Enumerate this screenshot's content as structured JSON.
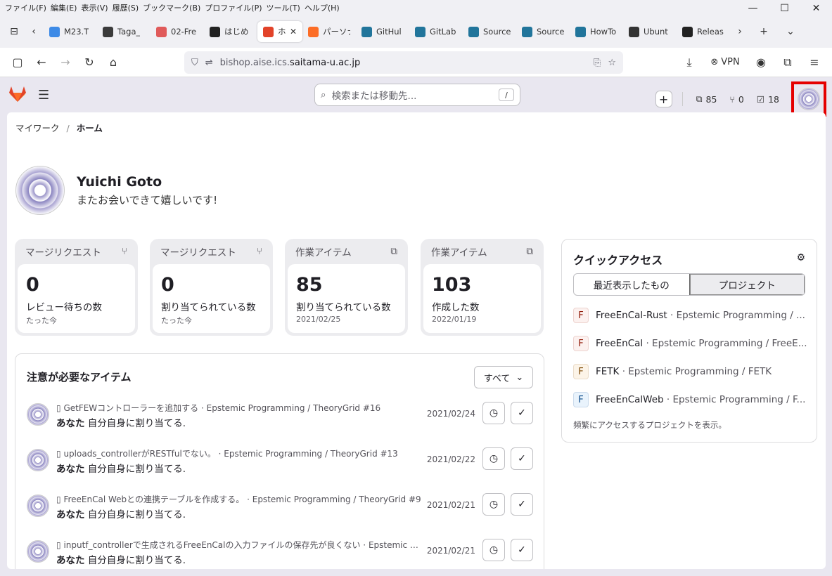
{
  "menu": [
    "ファイル(F)",
    "編集(E)",
    "表示(V)",
    "履歴(S)",
    "ブックマーク(B)",
    "プロファイル(P)",
    "ツール(T)",
    "ヘルプ(H)"
  ],
  "tabs": [
    {
      "label": "M23.T",
      "color": "#3d8ae6"
    },
    {
      "label": "Taga_",
      "color": "#3b3b3b"
    },
    {
      "label": "02-Fre",
      "color": "#e05a5a"
    },
    {
      "label": "はじめ",
      "color": "#222"
    },
    {
      "label": "ホー",
      "color": "#e24329",
      "active": true
    },
    {
      "label": "パーソナ",
      "color": "#fc6d26"
    },
    {
      "label": "GitHul",
      "color": "#21759b"
    },
    {
      "label": "GitLab",
      "color": "#21759b"
    },
    {
      "label": "Source",
      "color": "#21759b"
    },
    {
      "label": "Source",
      "color": "#21759b"
    },
    {
      "label": "HowTo",
      "color": "#21759b"
    },
    {
      "label": "Ubunt",
      "color": "#333"
    },
    {
      "label": "Releas",
      "color": "#222"
    }
  ],
  "url": {
    "prefix": "bishop.aise.ics.",
    "domain": "saitama-u.ac.jp"
  },
  "vpn": "VPN",
  "gl": {
    "search_placeholder": "検索または移動先...",
    "kbd": "/",
    "counts": {
      "issues": "85",
      "mrs": "0",
      "todos": "18"
    }
  },
  "breadcrumb": {
    "parent": "マイワーク",
    "sep": "/",
    "current": "ホーム"
  },
  "user": {
    "name": "Yuichi Goto",
    "greeting": "またお会いできて嬉しいです!"
  },
  "cards": [
    {
      "title": "マージリクエスト",
      "num": "0",
      "label": "レビュー待ちの数",
      "sub": "たった今"
    },
    {
      "title": "マージリクエスト",
      "num": "0",
      "label": "割り当てられている数",
      "sub": "たった今"
    },
    {
      "title": "作業アイテム",
      "num": "85",
      "label": "割り当てられている数",
      "sub": "2021/02/25"
    },
    {
      "title": "作業アイテム",
      "num": "103",
      "label": "作成した数",
      "sub": "2022/01/19"
    }
  ],
  "attention": {
    "title": "注意が必要なアイテム",
    "filter": "すべて",
    "rows": [
      {
        "text": "GetFEWコントローラーを追加する · Epstemic Programming / TheoryGrid #16",
        "who": "あなた",
        "action": "自分自身に割り当てる.",
        "date": "2021/02/24"
      },
      {
        "text": "uploads_controllerがRESTfulでない。 · Epstemic Programming / TheoryGrid #13",
        "who": "あなた",
        "action": "自分自身に割り当てる.",
        "date": "2021/02/22"
      },
      {
        "text": "FreeEnCal Webとの連携テーブルを作成する。 · Epstemic Programming / TheoryGrid #9",
        "who": "あなた",
        "action": "自分自身に割り当てる.",
        "date": "2021/02/21"
      },
      {
        "text": "inputf_controllerで生成されるFreeEnCalの入力ファイルの保存先が良くない · Epstemic Pr...",
        "who": "あなた",
        "action": "自分自身に割り当てる.",
        "date": "2021/02/21"
      }
    ]
  },
  "quick": {
    "title": "クイックアクセス",
    "seg": [
      "最近表示したもの",
      "プロジェクト"
    ],
    "items": [
      {
        "icon": "F",
        "name": "FreeEnCal-Rust",
        "ns": " · Epstemic Programming / ...",
        "bg": "#fcf1ef",
        "fg": "#8d1300"
      },
      {
        "icon": "F",
        "name": "FreeEnCal",
        "ns": " · Epstemic Programming / FreeE...",
        "bg": "#fcf1ef",
        "fg": "#8d1300"
      },
      {
        "icon": "F",
        "name": "FETK",
        "ns": " · Epstemic Programming / FETK",
        "bg": "#fcf4e8",
        "fg": "#7a4500"
      },
      {
        "icon": "F",
        "name": "FreeEnCalWeb",
        "ns": " · Epstemic Programming / F...",
        "bg": "#e9f3fc",
        "fg": "#064787"
      }
    ],
    "footer": "頻繁にアクセスするプロジェクトを表示。"
  }
}
